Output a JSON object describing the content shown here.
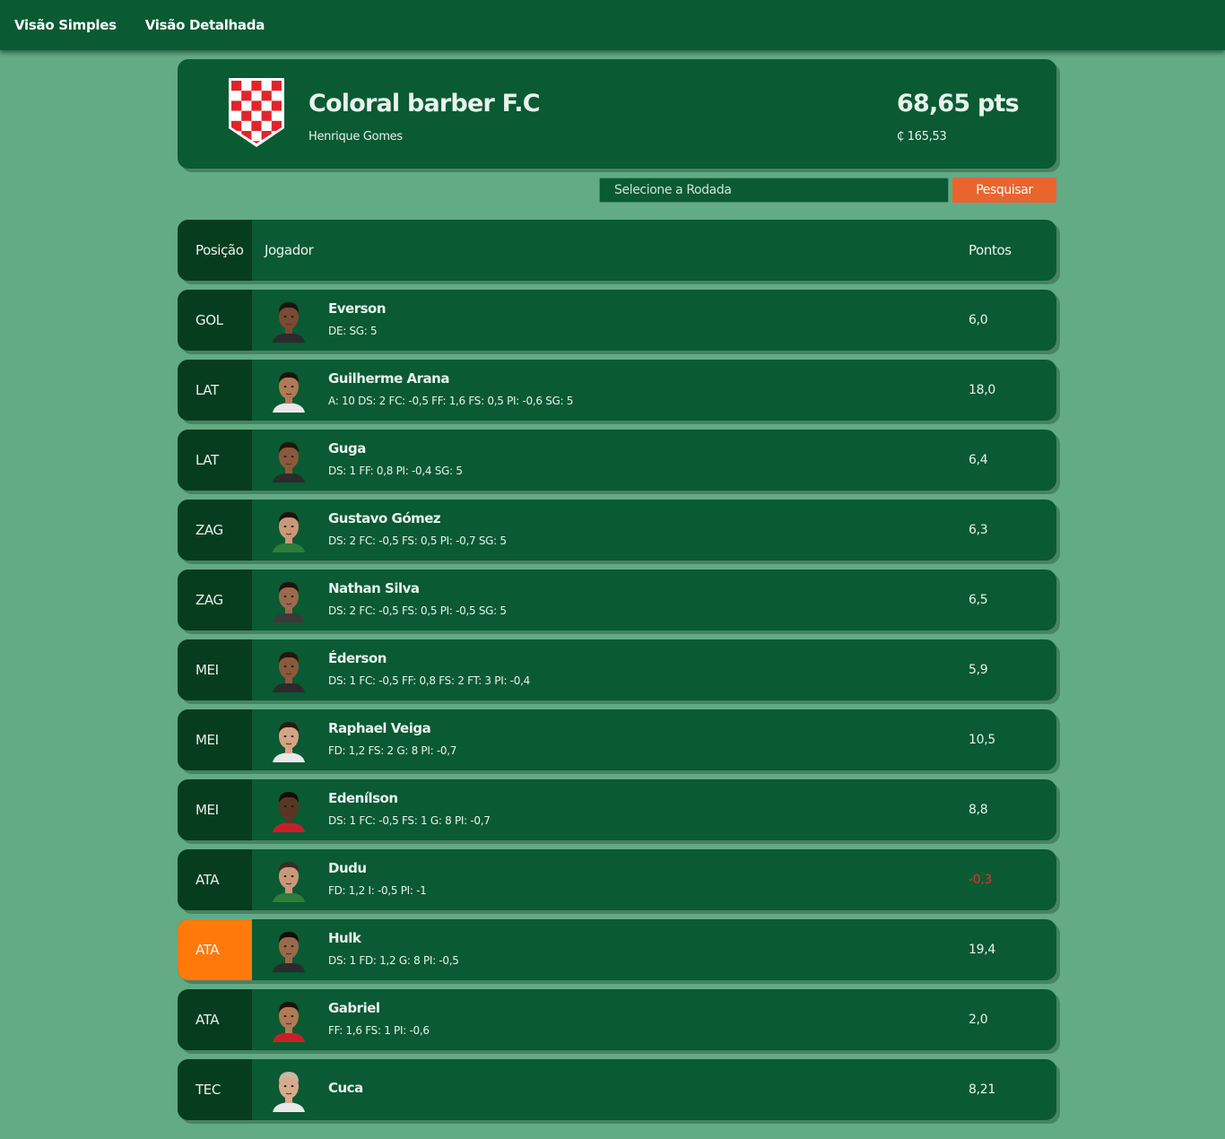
{
  "nav": {
    "simple_view": "Visão Simples",
    "detailed_view": "Visão Detalhada"
  },
  "team": {
    "name": "Coloral barber F.C",
    "owner": "Henrique Gomes",
    "points": "68,65 pts",
    "money": "₵ 165,53",
    "badge_colors": {
      "red": "#e2232a",
      "white": "#ffffff"
    }
  },
  "search": {
    "placeholder": "Selecione a Rodada",
    "button": "Pesquisar"
  },
  "table": {
    "headers": {
      "position": "Posição",
      "player": "Jogador",
      "points": "Pontos"
    },
    "rows": [
      {
        "pos": "GOL",
        "name": "Everson",
        "stats": "DE: SG: 5",
        "points": "6,0",
        "skin": "#7a4a33",
        "hair": "#1c130e",
        "shirt": "#2b2b2b"
      },
      {
        "pos": "LAT",
        "name": "Guilherme Arana",
        "stats": "A: 10 DS: 2 FC: -0,5 FF: 1,6 FS: 0,5 PI: -0,6 SG: 5",
        "points": "18,0",
        "skin": "#b07a56",
        "hair": "#1c130e",
        "shirt": "#e8e8e8"
      },
      {
        "pos": "LAT",
        "name": "Guga",
        "stats": "DS: 1 FF: 0,8 PI: -0,4 SG: 5",
        "points": "6,4",
        "skin": "#8a5a3d",
        "hair": "#241509",
        "shirt": "#2b2b2b"
      },
      {
        "pos": "ZAG",
        "name": "Gustavo Gómez",
        "stats": "DS: 2 FC: -0,5 FS: 0,5 PI: -0,7 SG: 5",
        "points": "6,3",
        "skin": "#c9987a",
        "hair": "#1c130e",
        "shirt": "#2e7d3a"
      },
      {
        "pos": "ZAG",
        "name": "Nathan Silva",
        "stats": "DS: 2 FC: -0,5 FS: 0,5 PI: -0,5 SG: 5",
        "points": "6,5",
        "skin": "#9a6a4d",
        "hair": "#1c130e",
        "shirt": "#3a3a3a"
      },
      {
        "pos": "MEI",
        "name": "Éderson",
        "stats": "DS: 1 FC: -0,5 FF: 0,8 FS: 2 FT: 3 PI: -0,4",
        "points": "5,9",
        "skin": "#8a5a3d",
        "hair": "#241509",
        "shirt": "#2b2b2b"
      },
      {
        "pos": "MEI",
        "name": "Raphael Veiga",
        "stats": "FD: 1,2 FS: 2 G: 8 PI: -0,7",
        "points": "10,5",
        "skin": "#d4a584",
        "hair": "#2b1a10",
        "shirt": "#e8e8e8"
      },
      {
        "pos": "MEI",
        "name": "Edenílson",
        "stats": "DS: 1 FC: -0,5 FS: 1 G: 8 PI: -0,7",
        "points": "8,8",
        "skin": "#5a3625",
        "hair": "#140c08",
        "shirt": "#c8202a"
      },
      {
        "pos": "ATA",
        "name": "Dudu",
        "stats": "FD: 1,2 I: -0,5 PI: -1",
        "points": "-0,3",
        "negative": true,
        "skin": "#c9987a",
        "hair": "#3a2a20",
        "shirt": "#2e7d3a"
      },
      {
        "pos": "ATA",
        "name": "Hulk",
        "stats": "DS: 1 FD: 1,2 G: 8 PI: -0,5",
        "points": "19,4",
        "captain": true,
        "skin": "#9a6a4d",
        "hair": "#140c08",
        "shirt": "#2b2b2b"
      },
      {
        "pos": "ATA",
        "name": "Gabriel",
        "stats": "FF: 1,6 FS: 1 PI: -0,6",
        "points": "2,0",
        "skin": "#b07a56",
        "hair": "#1c130e",
        "shirt": "#c8202a"
      },
      {
        "pos": "TEC",
        "name": "Cuca",
        "stats": "",
        "points": "8,21",
        "skin": "#d9ab8c",
        "hair": "#c8b8a8",
        "shirt": "#e8e8e8"
      }
    ]
  }
}
